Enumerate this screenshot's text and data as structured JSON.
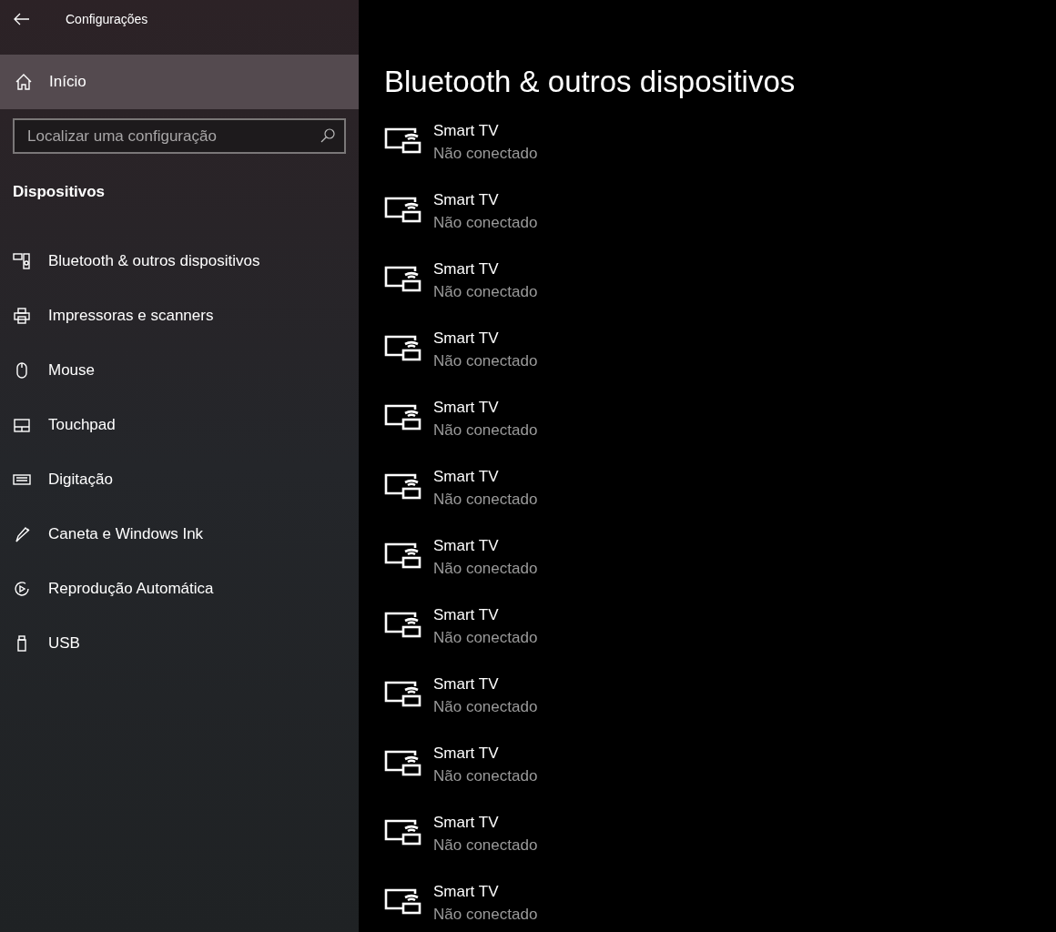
{
  "window": {
    "title": "Configurações"
  },
  "home": {
    "label": "Início"
  },
  "search": {
    "placeholder": "Localizar uma configuração"
  },
  "section": {
    "title": "Dispositivos"
  },
  "nav": [
    {
      "kind": "bluetooth",
      "label": "Bluetooth & outros dispositivos"
    },
    {
      "kind": "printer",
      "label": "Impressoras e scanners"
    },
    {
      "kind": "mouse",
      "label": "Mouse"
    },
    {
      "kind": "touchpad",
      "label": "Touchpad"
    },
    {
      "kind": "keyboard",
      "label": "Digitação"
    },
    {
      "kind": "pen",
      "label": "Caneta e Windows Ink"
    },
    {
      "kind": "autoplay",
      "label": "Reprodução Automática"
    },
    {
      "kind": "usb",
      "label": "USB"
    }
  ],
  "page": {
    "title": "Bluetooth & outros dispositivos"
  },
  "devices": [
    {
      "name": "Smart TV",
      "status": "Não conectado"
    },
    {
      "name": "Smart TV",
      "status": "Não conectado"
    },
    {
      "name": "Smart TV",
      "status": "Não conectado"
    },
    {
      "name": "Smart TV",
      "status": "Não conectado"
    },
    {
      "name": "Smart TV",
      "status": "Não conectado"
    },
    {
      "name": "Smart TV",
      "status": "Não conectado"
    },
    {
      "name": "Smart TV",
      "status": "Não conectado"
    },
    {
      "name": "Smart TV",
      "status": "Não conectado"
    },
    {
      "name": "Smart TV",
      "status": "Não conectado"
    },
    {
      "name": "Smart TV",
      "status": "Não conectado"
    },
    {
      "name": "Smart TV",
      "status": "Não conectado"
    },
    {
      "name": "Smart TV",
      "status": "Não conectado"
    }
  ]
}
